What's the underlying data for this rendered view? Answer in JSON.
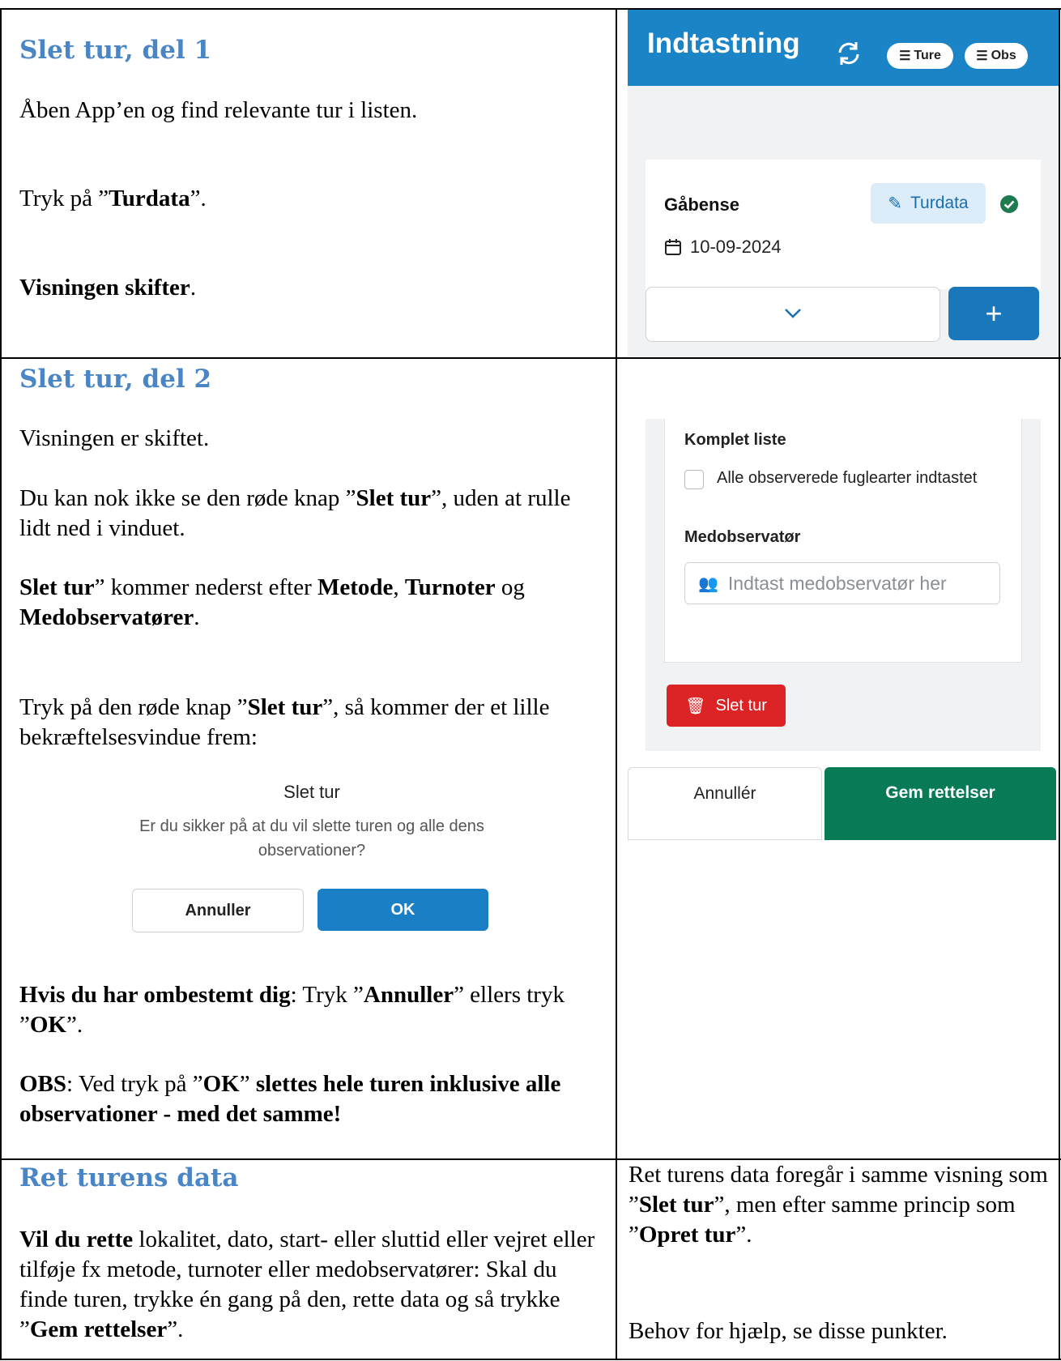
{
  "row1": {
    "heading": "Slet tur, del 1",
    "para1": "Åben App’en og find relevante tur i listen.",
    "para2_pre": "Tryk på ”",
    "para2_bold": "Turdata",
    "para2_post": "”.",
    "para3_bold": "Visningen skifter",
    "para3_post": "."
  },
  "app1": {
    "title": "Indtastning",
    "pill_ture": "Ture",
    "pill_obs": "Obs",
    "trip_name": "Gåbense",
    "turdata_label": "Turdata",
    "date": "10-09-2024",
    "plus": "+",
    "icons": [
      "sync-icon",
      "sort-icon",
      "edit-icon",
      "check-circle-icon",
      "calendar-icon",
      "chevron-down-icon"
    ]
  },
  "row2": {
    "heading": "Slet tur, del 2",
    "para1": "Visningen er skiftet.",
    "para2_pre": "Du kan nok ikke se den røde knap ”",
    "para2_bold": "Slet tur",
    "para2_post": "”, uden at rulle lidt ned i vinduet.",
    "para3_b1": "Slet tur",
    "para3_t1": "” kommer nederst efter ",
    "para3_b2": "Metode",
    "para3_t2": ", ",
    "para3_b3": "Turnoter",
    "para3_t3": " og ",
    "para3_b4": "Medobservatører",
    "para3_t4": ".",
    "para4_pre": "Tryk på den røde knap ”",
    "para4_bold": "Slet tur",
    "para4_post": "”, så kommer der et lille bekræftelsesvindue frem:",
    "para5_b1": "Hvis du har ombestemt dig",
    "para5_t1": ": Tryk ”",
    "para5_b2": "Annuller",
    "para5_t2": "” ellers tryk ”",
    "para5_b3": "OK",
    "para5_t3": "”.",
    "para6_b1": "OBS",
    "para6_t1": ": Ved tryk på ”",
    "para6_b2": "OK",
    "para6_t2": "” ",
    "para6_b3": "slettes hele turen inklusive alle observationer - med det samme!"
  },
  "dialog": {
    "title": "Slet tur",
    "message": "Er du sikker på at du vil slette turen og alle dens observationer?",
    "cancel": "Annuller",
    "ok": "OK"
  },
  "app2": {
    "komplet_label": "Komplet liste",
    "checkbox_text": "Alle observerede fuglearter indtastet",
    "medobs_label": "Medobservatør",
    "medobs_placeholder": "Indtast medobservatør her",
    "slet_button": "Slet tur",
    "annuller_button": "Annullér",
    "gem_button": "Gem rettelser"
  },
  "row3": {
    "heading": "Ret turens data",
    "left_b1": "Vil du rette",
    "left_t1": " lokalitet, dato, start- eller sluttid eller vejret eller tilføje fx metode, turnoter eller medobservatører: Skal du finde turen, trykke én gang på den, rette data og så trykke ”",
    "left_b2": "Gem rettelser",
    "left_t2": "”.",
    "right_t1": "Ret turens data foregår i samme visning som ”",
    "right_b1": "Slet tur",
    "right_t2": "”, men efter samme princip som ”",
    "right_b2": "Opret tur",
    "right_t3": "”.",
    "right_para2": "Behov for hjælp, se disse punkter."
  },
  "colors": {
    "heading": "#4a86c5",
    "appbar": "#1a84c7",
    "delete": "#dc2326",
    "save": "#087a55",
    "ok": "#1a7fc4"
  }
}
